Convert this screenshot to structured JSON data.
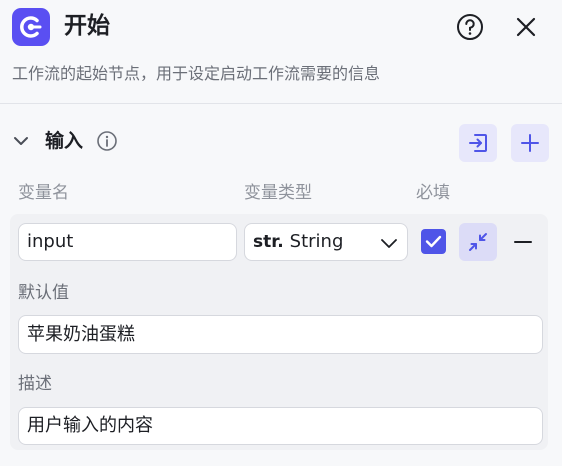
{
  "header": {
    "title": "开始",
    "subtitle": "工作流的起始节点，用于设定启动工作流需要的信息",
    "icons": [
      "start-node-icon",
      "help-icon",
      "close-icon"
    ]
  },
  "input_section": {
    "title": "输入",
    "icons": [
      "chevron-down-icon",
      "info-icon",
      "import-icon",
      "plus-icon"
    ],
    "columns": {
      "name": "变量名",
      "type": "变量类型",
      "required": "必填"
    },
    "variable": {
      "name": "input",
      "type_prefix": "str.",
      "type": "String",
      "required": true,
      "default_label": "默认值",
      "default_value": "苹果奶油蛋糕",
      "desc_label": "描述",
      "desc_value": "用户输入的内容"
    }
  },
  "colors": {
    "accent": "#5a4ff2",
    "checkbox": "#4f55e8",
    "button_bg": "#e7e7fb"
  }
}
